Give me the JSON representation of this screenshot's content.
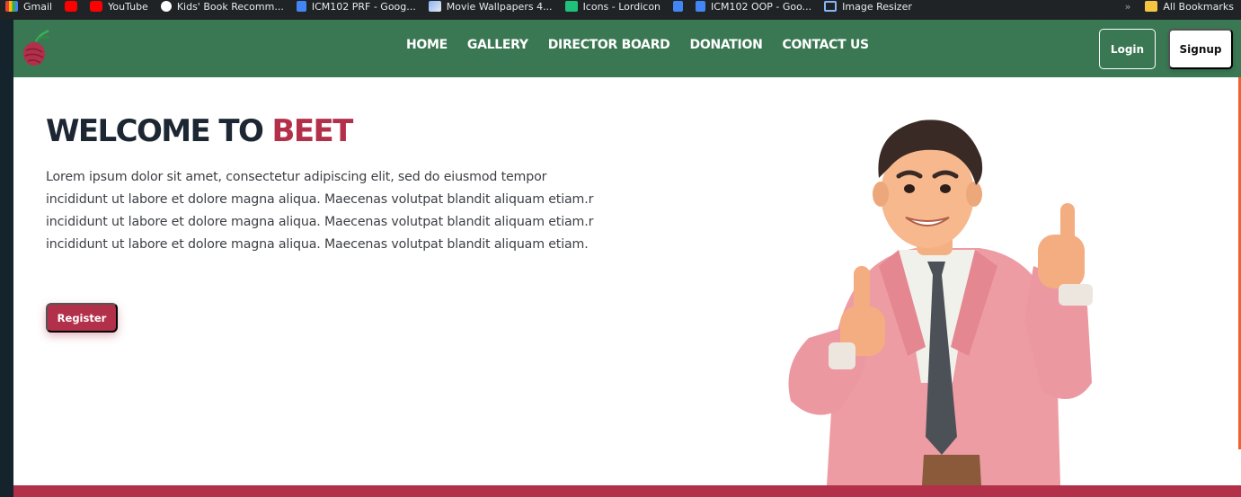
{
  "browser": {
    "bookmarks": [
      {
        "label": "Gmail",
        "icon": "gmail-icon"
      },
      {
        "label": "",
        "icon": "youtube-icon"
      },
      {
        "label": "YouTube",
        "icon": "youtube-icon"
      },
      {
        "label": "Kids' Book Recomm...",
        "icon": "chatgpt-icon"
      },
      {
        "label": "ICM102 PRF - Goog...",
        "icon": "google-docs-icon"
      },
      {
        "label": "Movie Wallpapers 4...",
        "icon": "image-icon"
      },
      {
        "label": "Icons - Lordicon",
        "icon": "lordicon-icon"
      },
      {
        "label": "",
        "icon": "google-docs-icon"
      },
      {
        "label": "ICM102 OOP - Goo...",
        "icon": "google-docs-icon"
      },
      {
        "label": "Image Resizer",
        "icon": "resize-icon"
      }
    ],
    "more": "»",
    "all_bookmarks": "All Bookmarks"
  },
  "navbar": {
    "links": [
      "HOME",
      "GALLERY",
      "DIRECTOR BOARD",
      "DONATION",
      "CONTACT US"
    ],
    "login": "Login",
    "signup": "Signup"
  },
  "hero": {
    "title_prefix": "WELCOME TO",
    "title_brand": "BEET",
    "text": "Lorem ipsum dolor sit amet, consectetur adipiscing elit, sed do eiusmod tempor incididunt ut labore et dolore magna aliqua. Maecenas volutpat blandit aliquam etiam.r incididunt ut labore et dolore magna aliqua. Maecenas volutpat blandit aliquam etiam.r incididunt ut labore et dolore magna aliqua. Maecenas volutpat blandit aliquam etiam.",
    "register": "Register"
  },
  "colors": {
    "nav_green": "#3a7753",
    "brand_red": "#b3304a",
    "title_dark": "#1d2733"
  }
}
